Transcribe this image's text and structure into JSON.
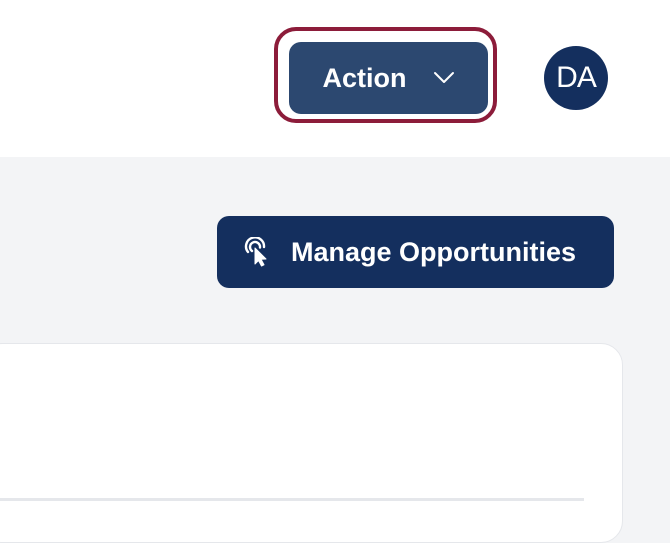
{
  "header": {
    "action_label": "Action",
    "avatar_initials": "DA"
  },
  "main": {
    "manage_label": "Manage Opportunities"
  },
  "colors": {
    "primary_navy": "#142f5e",
    "action_blue": "#2c4870",
    "focus_ring": "#8c1c3a",
    "background": "#f3f4f6"
  },
  "icons": {
    "action_chevron": "chevron-down-icon",
    "manage_icon": "click-pointer-icon"
  }
}
